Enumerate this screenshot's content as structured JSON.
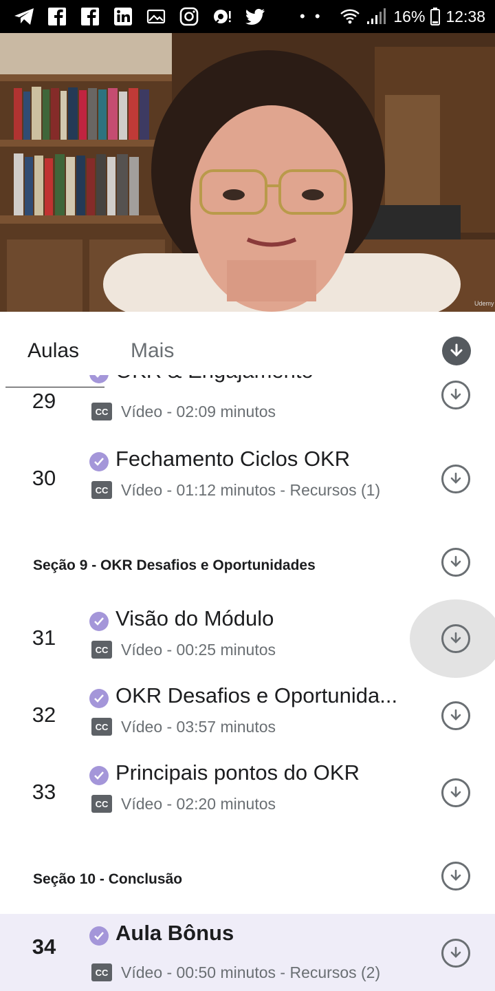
{
  "status_bar": {
    "icons": [
      "telegram-icon",
      "facebook-icon",
      "facebook-icon",
      "linkedin-icon",
      "gallery-icon",
      "instagram-icon",
      "podcast-icon",
      "twitter-icon"
    ],
    "dots": "• •",
    "battery": "16%",
    "time": "12:38"
  },
  "video": {
    "watermark": "Udemy"
  },
  "tabs": [
    {
      "label": "Aulas",
      "active": true
    },
    {
      "label": "Mais",
      "active": false
    }
  ],
  "list": {
    "partial_lesson": {
      "number": "29",
      "title": "OKR & Engajamento",
      "meta": "Vídeo - 02:09 minutos"
    },
    "lessons_a": [
      {
        "number": "30",
        "title": "Fechamento Ciclos OKR",
        "meta": "Vídeo - 01:12 minutos - Recursos (1)"
      }
    ],
    "section_9": "Seção 9 - OKR  Desafios e Oportunidades",
    "lessons_b": [
      {
        "number": "31",
        "title": "Visão do Módulo",
        "meta": "Vídeo - 00:25 minutos"
      },
      {
        "number": "32",
        "title": "OKR Desafios e Oportunida...",
        "meta": "Vídeo - 03:57 minutos"
      },
      {
        "number": "33",
        "title": "Principais pontos do OKR",
        "meta": "Vídeo - 02:20 minutos"
      }
    ],
    "section_10": "Seção 10 - Conclusão",
    "active_lesson": {
      "number": "34",
      "title": "Aula Bônus",
      "meta": "Vídeo - 00:50 minutos - Recursos (2)"
    },
    "cc_label": "CC"
  },
  "colors": {
    "accent_check": "#a496d9",
    "active_row": "#efedf8",
    "icon_gray": "#6a6f73"
  }
}
